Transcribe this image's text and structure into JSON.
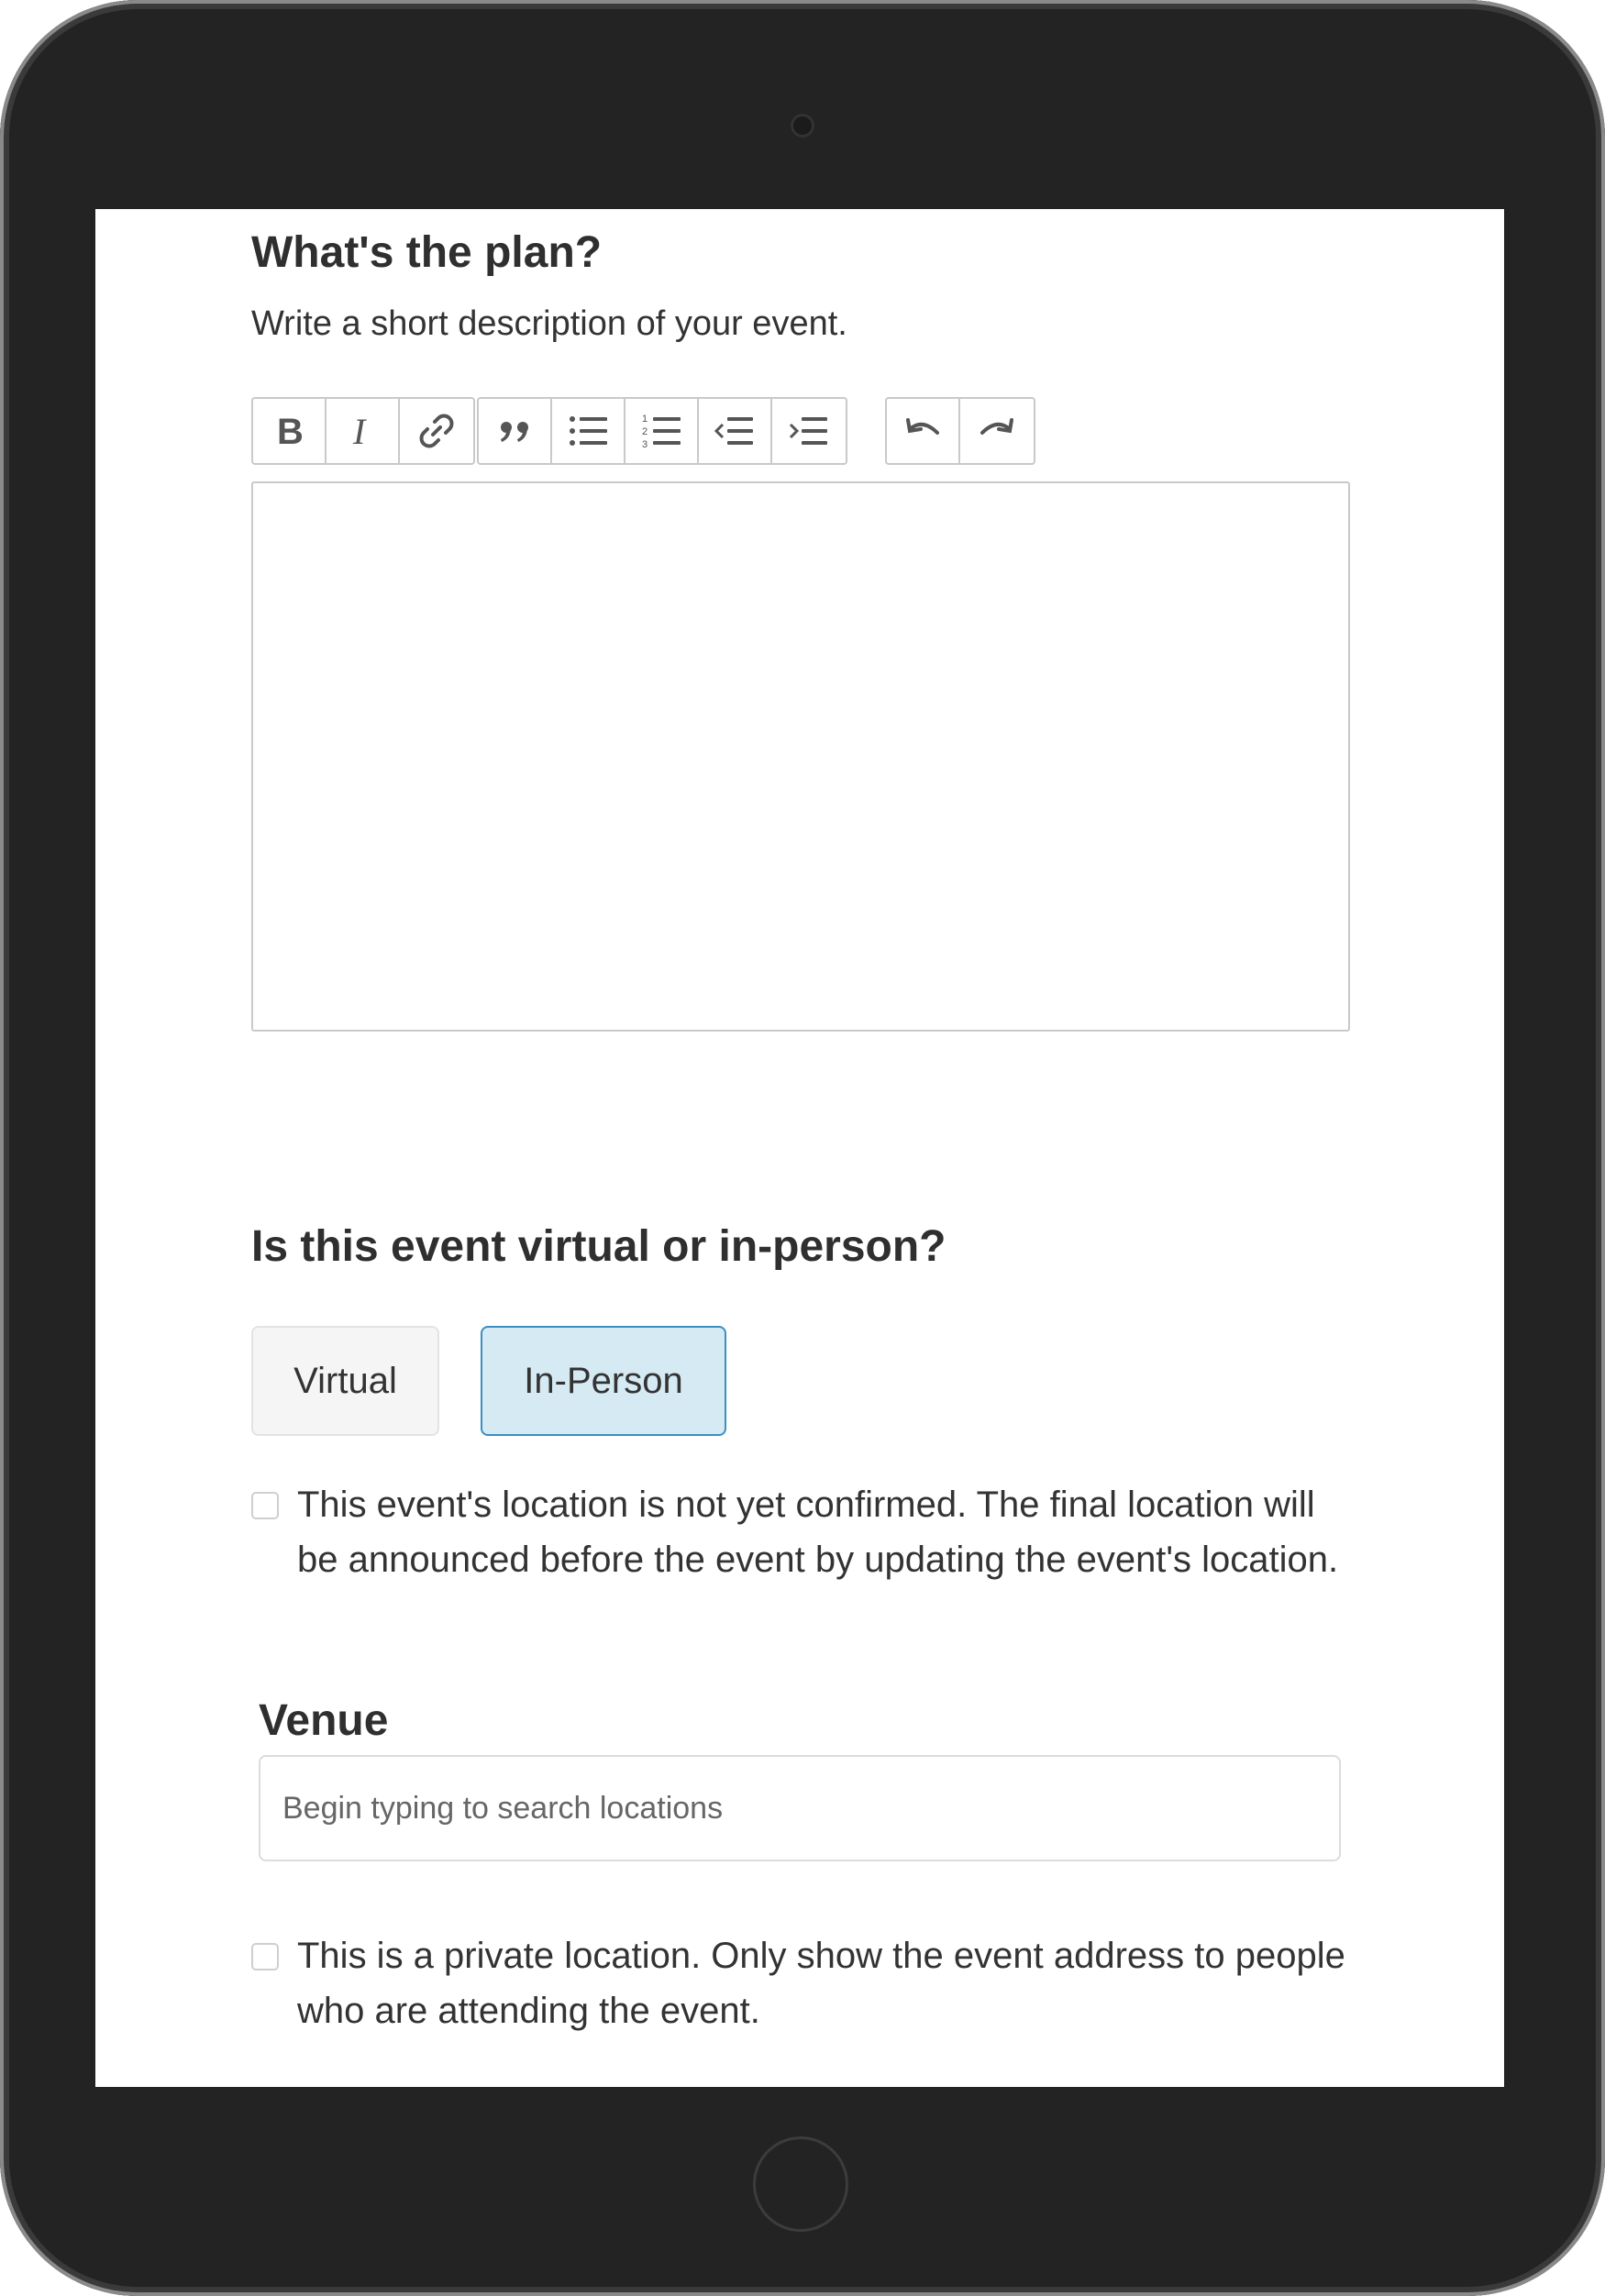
{
  "plan": {
    "title": "What's the plan?",
    "description": "Write a short description of your event."
  },
  "toolbar": {
    "groups": [
      [
        "bold-icon",
        "italic-icon",
        "link-icon"
      ],
      [
        "quote-icon",
        "bullet-list-icon",
        "numbered-list-icon",
        "outdent-icon",
        "indent-icon"
      ],
      [
        "undo-icon",
        "redo-icon"
      ]
    ]
  },
  "editor": {
    "value": ""
  },
  "mode": {
    "title": "Is this event virtual or in-person?",
    "options": [
      "Virtual",
      "In-Person"
    ],
    "selected": "In-Person"
  },
  "location_unconfirmed": {
    "checked": false,
    "label": "This event's location is not yet confirmed. The final location will be announced before the event by updating the event's location."
  },
  "venue": {
    "label": "Venue",
    "value": "",
    "placeholder": "Begin typing to search locations"
  },
  "private_location": {
    "checked": false,
    "label": "This is a private location. Only show the event address to people who are attending the event."
  },
  "colors": {
    "selected_bg": "#d6eaf4",
    "selected_border": "#3b8fc2",
    "device_bezel": "#232323"
  }
}
